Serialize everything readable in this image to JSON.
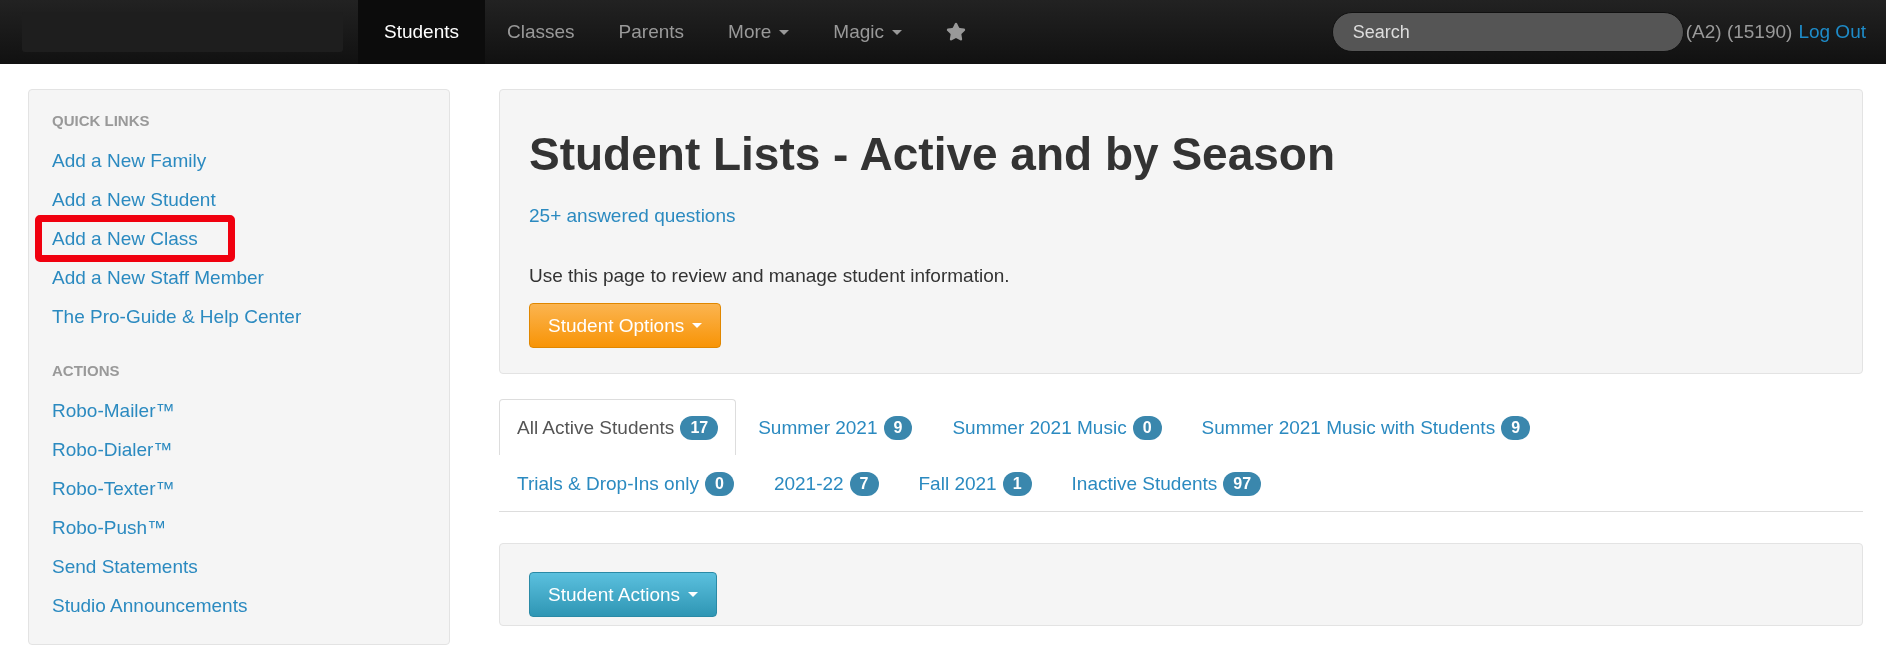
{
  "navbar": {
    "items": [
      {
        "label": "Students",
        "selected": true,
        "kind": "link"
      },
      {
        "label": "Classes",
        "selected": false,
        "kind": "link"
      },
      {
        "label": "Parents",
        "selected": false,
        "kind": "link"
      },
      {
        "label": "More",
        "selected": false,
        "kind": "dropdown"
      },
      {
        "label": "Magic",
        "selected": false,
        "kind": "dropdown"
      },
      {
        "selected": false,
        "kind": "star"
      }
    ],
    "search": {
      "placeholder": "Search"
    },
    "account": "(A2) (15190)",
    "logout": "Log Out"
  },
  "sidebar": {
    "sections": [
      {
        "heading": "QUICK LINKS",
        "links": [
          {
            "label": "Add a New Family",
            "highlighted": false
          },
          {
            "label": "Add a New Student",
            "highlighted": false
          },
          {
            "label": "Add a New Class",
            "highlighted": true
          },
          {
            "label": "Add a New Staff Member",
            "highlighted": false
          },
          {
            "label": "The Pro-Guide & Help Center",
            "highlighted": false
          }
        ]
      },
      {
        "heading": "ACTIONS",
        "links": [
          {
            "label": "Robo-Mailer™",
            "highlighted": false
          },
          {
            "label": "Robo-Dialer™",
            "highlighted": false
          },
          {
            "label": "Robo-Texter™",
            "highlighted": false
          },
          {
            "label": "Robo-Push™",
            "highlighted": false
          },
          {
            "label": "Send Statements",
            "highlighted": false
          },
          {
            "label": "Studio Announcements",
            "highlighted": false
          }
        ]
      }
    ]
  },
  "header": {
    "title": "Student Lists - Active and by Season",
    "help_link": "25+ answered questions",
    "description": "Use this page to review and manage student information.",
    "button": "Student Options"
  },
  "tab_rows": [
    [
      {
        "label": "All Active Students",
        "count": "17",
        "selected": true
      },
      {
        "label": "Summer 2021",
        "count": "9",
        "selected": false
      },
      {
        "label": "Summer 2021 Music",
        "count": "0",
        "selected": false
      },
      {
        "label": "Summer 2021 Music with Students",
        "count": "9",
        "selected": false
      }
    ],
    [
      {
        "label": "Trials & Drop-Ins only",
        "count": "0",
        "selected": false
      },
      {
        "label": "2021-22",
        "count": "7",
        "selected": false
      },
      {
        "label": "Fall 2021",
        "count": "1",
        "selected": false
      },
      {
        "label": "Inactive Students",
        "count": "97",
        "selected": false
      }
    ]
  ],
  "actions": {
    "button": "Student Actions"
  }
}
